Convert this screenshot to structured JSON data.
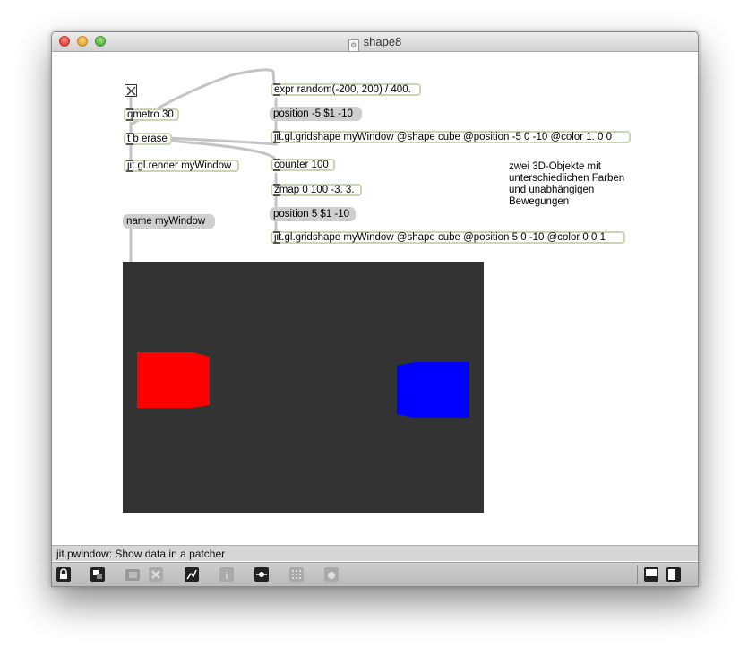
{
  "window": {
    "title": "shape8",
    "file_icon": "patcher-file-icon"
  },
  "patch": {
    "toggle": {
      "state": "on"
    },
    "qmetro": "qmetro 30",
    "t_b_erase": "t b erase",
    "jit_render": "jit.gl.render myWindow",
    "name_msg": "name myWindow",
    "expr": "expr random(-200, 200) / 400.",
    "position_msg_1": "position -5 $1 -10",
    "gridshape_1": "jit.gl.gridshape myWindow @shape cube @position -5 0 -10 @color 1. 0 0",
    "counter": "counter 100",
    "zmap": "zmap 0 100 -3. 3.",
    "position_msg_2": "position 5 $1 -10",
    "gridshape_2": "jit.gl.gridshape myWindow @shape cube @position 5 0 -10 @color 0 0 1",
    "comment": [
      "zwei 3D-Objekte mit",
      "unterschiedlichen Farben",
      "und unabhängigen",
      "Bewegungen"
    ]
  },
  "pwindow": {
    "background": "#333333",
    "cube_left_color": "#ff0000",
    "cube_right_color": "#0000ff"
  },
  "status": {
    "text": "jit.pwindow: Show data in a patcher"
  },
  "toolbar": {
    "items": [
      "lock-icon",
      "presentation-icon",
      "clipboard-icon",
      "delete-icon",
      "new-object-icon",
      "inspector-icon",
      "slider-icon",
      "grid-icon",
      "debug-icon"
    ],
    "right_items": [
      "bottom-panel-icon",
      "side-panel-icon"
    ]
  },
  "colors": {
    "object_border": "#c9d6b4",
    "message_bg": "#cfcfcf",
    "patchcord": "#c4c4c4"
  }
}
